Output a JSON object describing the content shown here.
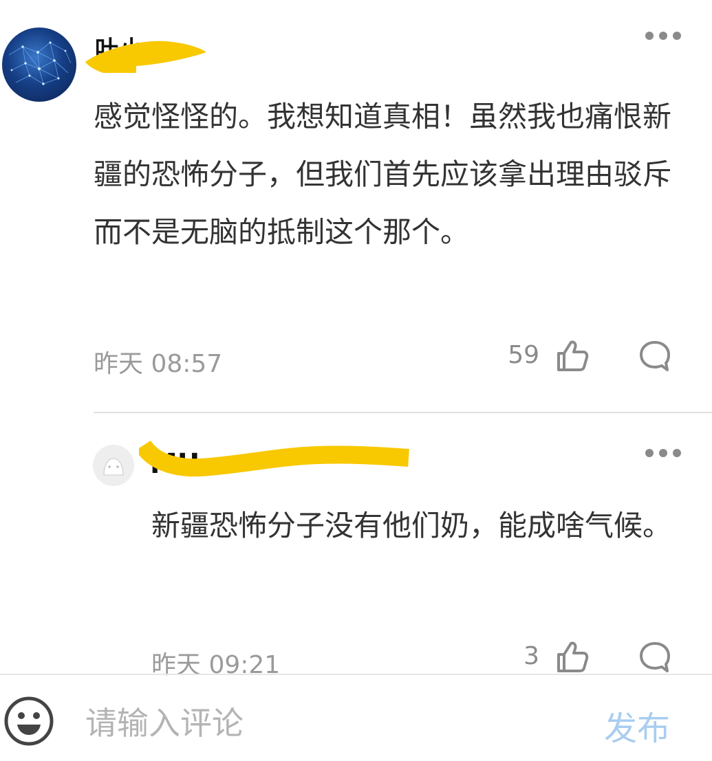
{
  "comments": [
    {
      "username": "叶小",
      "body": "感觉怪怪的。我想知道真相！虽然我也痛恨新疆的恐怖分子，但我们首先应该拿出理由驳斥而不是无脑的抵制这个那个。",
      "time": "昨天 08:57",
      "likes": "59"
    },
    {
      "username": "MU",
      "body": "新疆恐怖分子没有他们奶，能成啥气候。",
      "time": "昨天 09:21",
      "likes": "3"
    }
  ],
  "input_bar": {
    "placeholder": "请输入评论",
    "publish_label": "发布"
  },
  "icons": {
    "more": "more-dots-icon",
    "like": "thumbs-up-icon",
    "reply": "comment-bubble-icon",
    "emoji": "emoji-icon"
  },
  "colors": {
    "redaction": "#F8C800",
    "publish": "#A9CDF0",
    "meta_text": "#9A9A9A",
    "icon_gray": "#8A8A8A"
  }
}
